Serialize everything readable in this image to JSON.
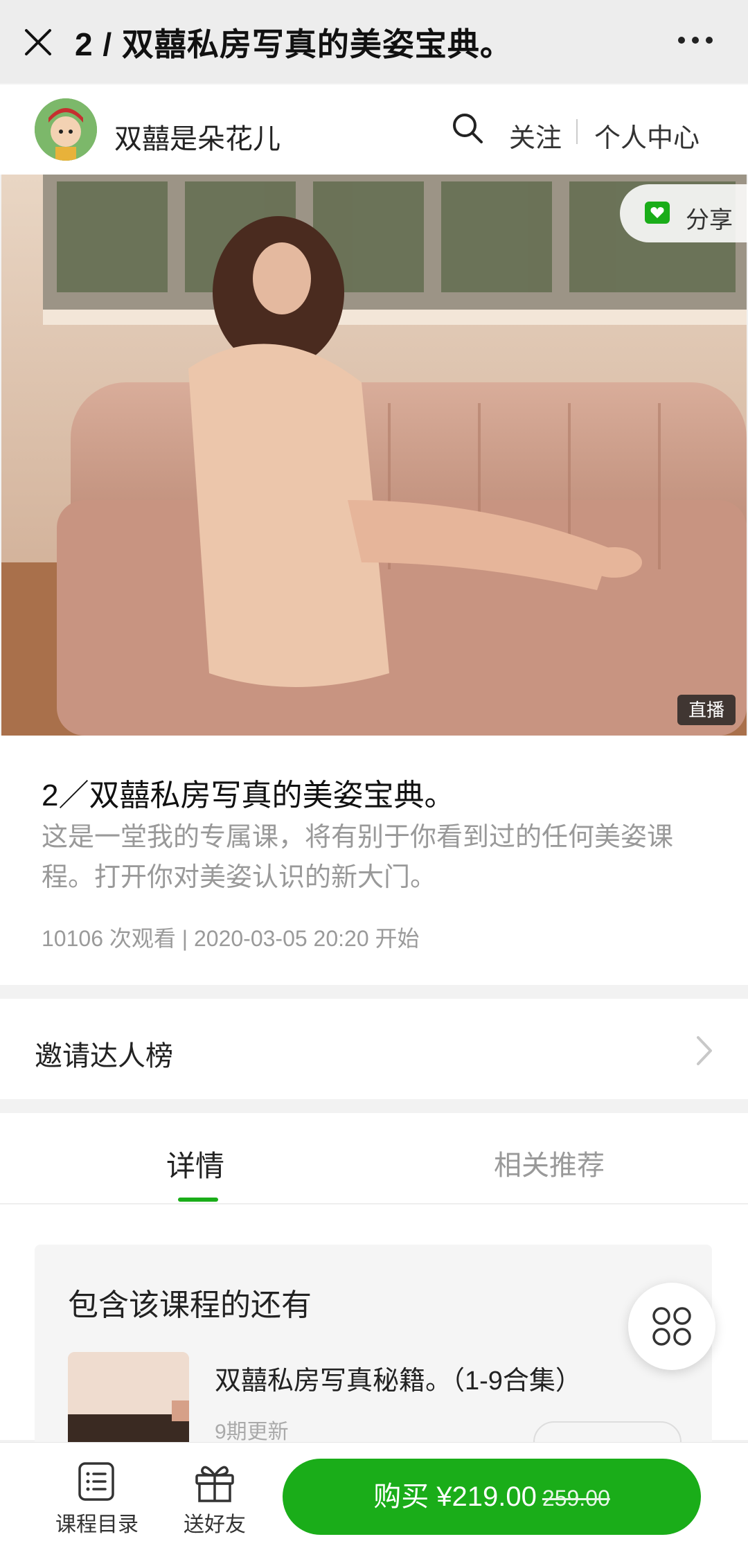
{
  "topbar": {
    "title": "2 / 双囍私房写真的美姿宝典。",
    "close_icon": "close-icon",
    "more_icon": "more-dots-icon"
  },
  "author": {
    "name": "双囍是朵花儿",
    "follow_label": "关注",
    "center_label": "个人中心"
  },
  "hero": {
    "share_label": "分享",
    "live_badge": "直播"
  },
  "course": {
    "title": "2／双囍私房写真的美姿宝典。",
    "description": "这是一堂我的专属课，将有别于你看到过的任何美姿课程。打开你对美姿认识的新大门。",
    "meta": "10106 次观看 | 2020-03-05 20:20 开始"
  },
  "invite": {
    "label": "邀请达人榜"
  },
  "tabs": [
    {
      "label": "详情",
      "active": true
    },
    {
      "label": "相关推荐",
      "active": false
    }
  ],
  "collection": {
    "heading": "包含该课程的还有",
    "item_title": "双囍私房写真秘籍。（1-9合集）",
    "item_meta": "9期更新"
  },
  "bottombar": {
    "toc_label": "课程目录",
    "gift_label": "送好友",
    "buy_label": "购买 ¥219.00",
    "buy_original_price": "259.00"
  },
  "colors": {
    "accent": "#1aad19",
    "topbar_bg": "#ededed"
  }
}
